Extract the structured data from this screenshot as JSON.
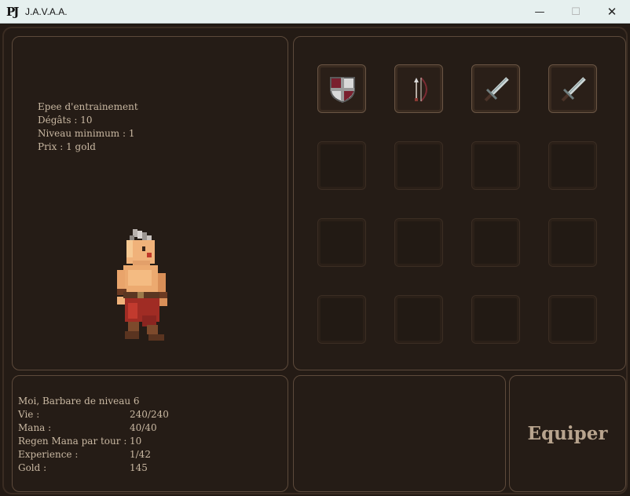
{
  "window": {
    "logo": "PJ",
    "title": "J.A.V.A.A.",
    "minimize_glyph": "—",
    "maximize_glyph": "☐",
    "close_glyph": "✕"
  },
  "item_detail": {
    "name": "Epee d'entrainement",
    "damage": "Dégâts : 10",
    "min_level": "Niveau minimum : 1",
    "price": "Prix : 1 gold"
  },
  "character": {
    "title": "Moi, Barbare de niveau 6",
    "stats": [
      {
        "label": "Vie :",
        "value": "240/240"
      },
      {
        "label": "Mana :",
        "value": "40/40"
      },
      {
        "label": "Regen Mana par tour :",
        "value": "10"
      },
      {
        "label": "Experience :",
        "value": "1/42"
      },
      {
        "label": "Gold :",
        "value": "145"
      }
    ]
  },
  "inventory": {
    "slots": [
      {
        "icon": "shield-icon"
      },
      {
        "icon": "bow-icon"
      },
      {
        "icon": "sword-icon"
      },
      {
        "icon": "sword-icon"
      },
      {
        "icon": null
      },
      {
        "icon": null
      },
      {
        "icon": null
      },
      {
        "icon": null
      },
      {
        "icon": null
      },
      {
        "icon": null
      },
      {
        "icon": null
      },
      {
        "icon": null
      },
      {
        "icon": null
      },
      {
        "icon": null
      },
      {
        "icon": null
      },
      {
        "icon": null
      }
    ]
  },
  "actions": {
    "equip_label": "Equiper"
  },
  "colors": {
    "background": "#231a14",
    "panel_border": "#5d4a3b",
    "text": "#c9b8a2",
    "shield_red": "#7a1f2e"
  }
}
